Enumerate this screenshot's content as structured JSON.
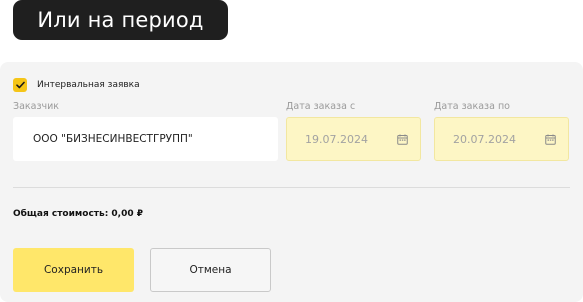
{
  "header": {
    "title": "Или на период"
  },
  "form": {
    "interval_checkbox": {
      "label": "Интервальная заявка",
      "checked": true
    },
    "customer": {
      "label": "Заказчик",
      "value": "ООО \"БИЗНЕСИНВЕСТГРУПП\""
    },
    "date_from": {
      "label": "Дата заказа с",
      "value": "19.07.2024",
      "icon": "calendar-icon"
    },
    "date_to": {
      "label": "Дата заказа по",
      "value": "20.07.2024",
      "icon": "calendar-icon"
    },
    "total": "Общая стоимость: 0,00 ₽",
    "save_label": "Сохранить",
    "cancel_label": "Отмена"
  },
  "colors": {
    "accent": "#f5c518",
    "save_button": "#ffe76a",
    "date_field_bg": "#fdf6c5",
    "title_bg": "#1f1f1f"
  }
}
